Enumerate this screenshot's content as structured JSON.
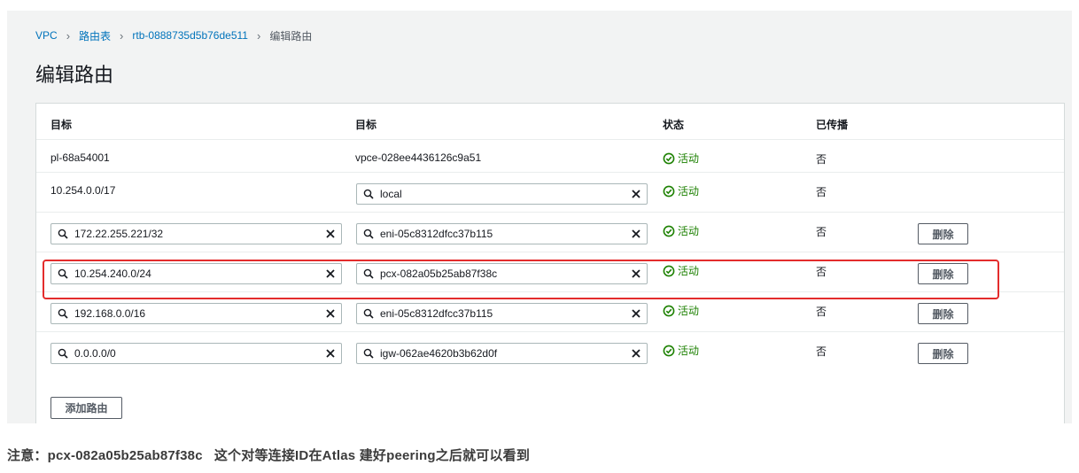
{
  "breadcrumb": {
    "items": [
      "VPC",
      "路由表",
      "rtb-0888735d5b76de511"
    ],
    "current": "编辑路由"
  },
  "page_title": "编辑路由",
  "table": {
    "headers": [
      "目标",
      "目标",
      "状态",
      "已传播"
    ],
    "rows": [
      {
        "destination": "pl-68a54001",
        "target": "vpce-028ee4436126c9a51",
        "status": "活动",
        "propagated": "否"
      },
      {
        "destination": "10.254.0.0/17",
        "target": "local",
        "status": "活动",
        "propagated": "否"
      },
      {
        "destination": "172.22.255.221/32",
        "target": "eni-05c8312dfcc37b115",
        "status": "活动",
        "propagated": "否",
        "remove": "删除"
      },
      {
        "destination": "10.254.240.0/24",
        "target": "pcx-082a05b25ab87f38c",
        "status": "活动",
        "propagated": "否",
        "remove": "删除"
      },
      {
        "destination": "192.168.0.0/16",
        "target": "eni-05c8312dfcc37b115",
        "status": "活动",
        "propagated": "否",
        "remove": "删除"
      },
      {
        "destination": "0.0.0.0/0",
        "target": "igw-062ae4620b3b62d0f",
        "status": "活动",
        "propagated": "否",
        "remove": "删除"
      }
    ]
  },
  "add_route_label": "添加路由",
  "note": "注意：pcx-082a05b25ab87f38c   这个对等连接ID在Atlas 建好peering之后就可以看到",
  "colors": {
    "link": "#0073bb",
    "status_ok": "#1d8102",
    "highlight": "#e32c2c"
  },
  "icons": {
    "field": "search-icon",
    "clear": "close-icon",
    "status": "check-circle-icon",
    "breadcrumb_separator": "chevron-right-icon"
  }
}
